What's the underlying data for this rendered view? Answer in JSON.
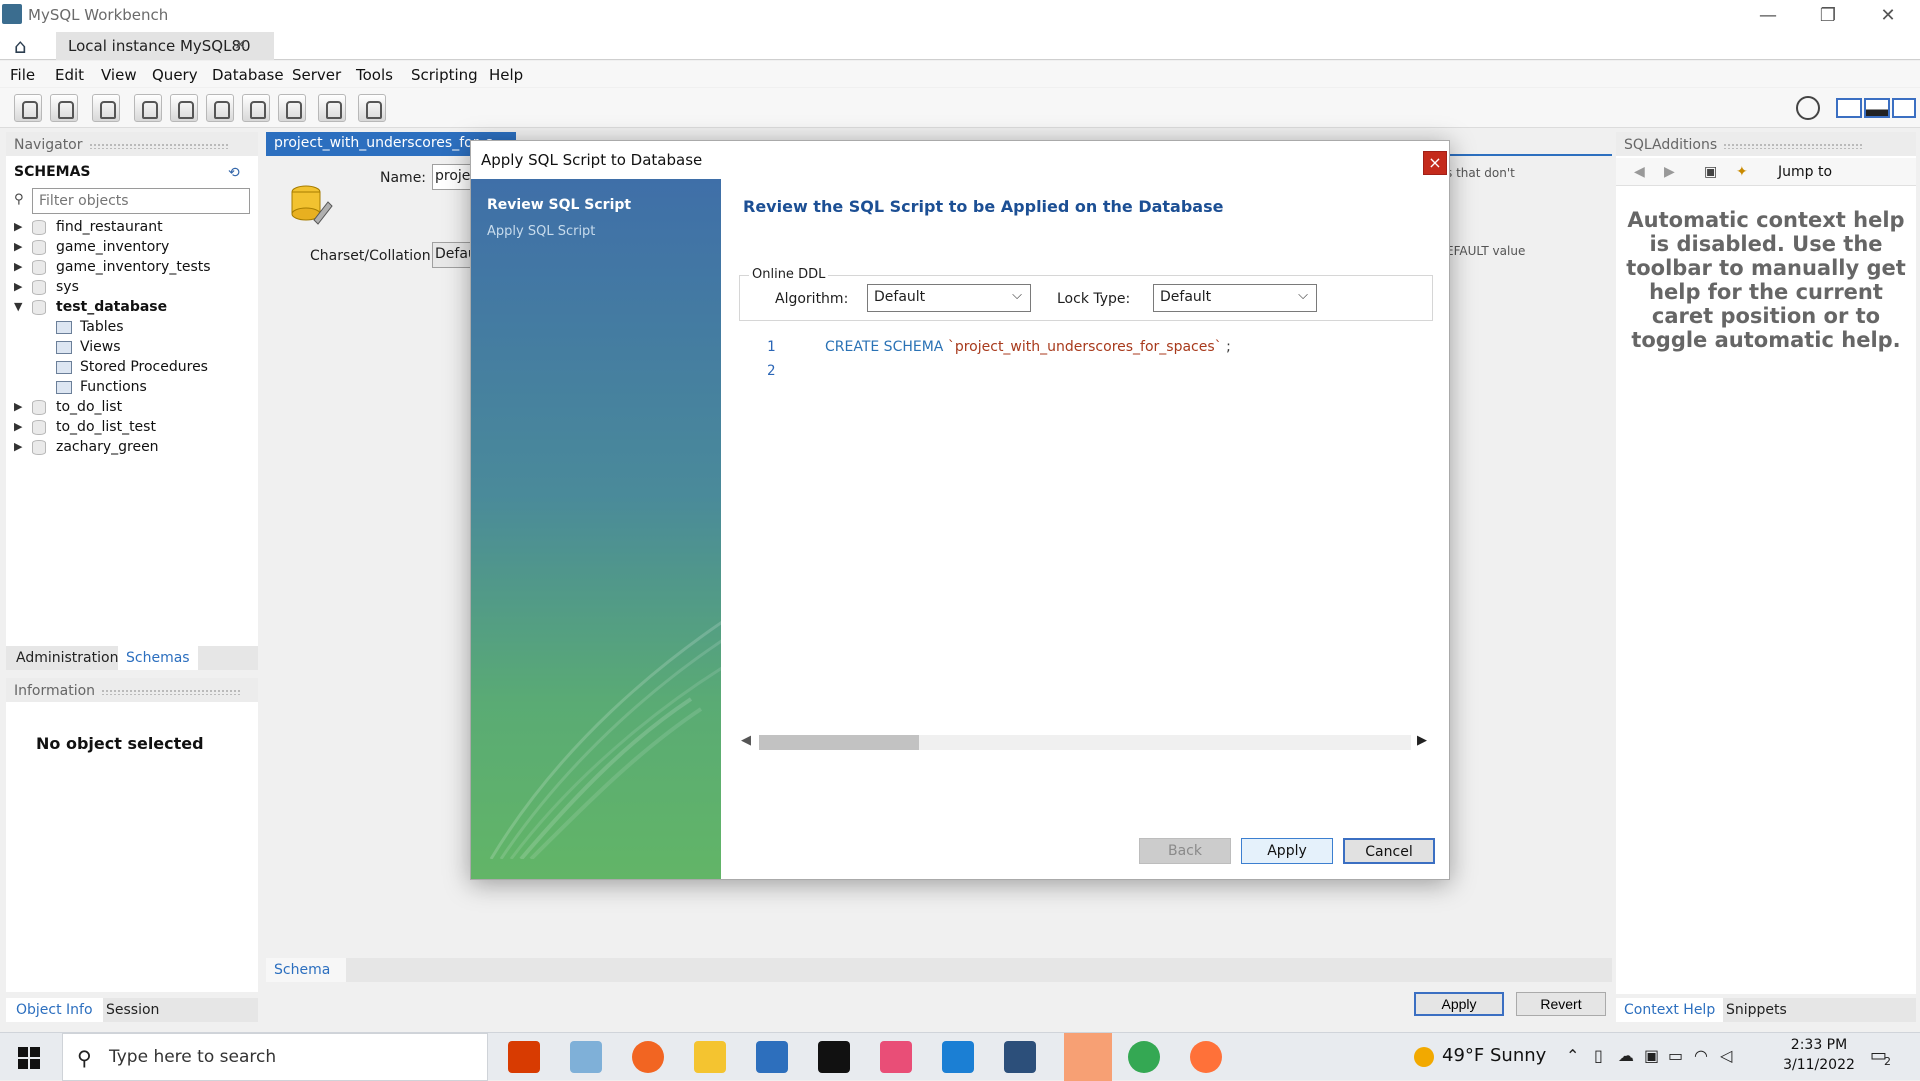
{
  "window": {
    "title": "MySQL Workbench",
    "controls": {
      "minimize": "—",
      "restore": "❐",
      "close": "✕"
    }
  },
  "connection_tab": {
    "label": "Local instance MySQL80",
    "close": "×"
  },
  "menu": [
    "File",
    "Edit",
    "View",
    "Query",
    "Database",
    "Server",
    "Tools",
    "Scripting",
    "Help"
  ],
  "navigator": {
    "header": "Navigator",
    "schemas_label": "SCHEMAS",
    "filter_placeholder": "Filter objects",
    "schemas": [
      {
        "name": "find_restaurant",
        "expanded": false
      },
      {
        "name": "game_inventory",
        "expanded": false
      },
      {
        "name": "game_inventory_tests",
        "expanded": false
      },
      {
        "name": "sys",
        "expanded": false
      },
      {
        "name": "test_database",
        "expanded": true,
        "children": [
          "Tables",
          "Views",
          "Stored Procedures",
          "Functions"
        ]
      },
      {
        "name": "to_do_list",
        "expanded": false
      },
      {
        "name": "to_do_list_test",
        "expanded": false
      },
      {
        "name": "zachary_green",
        "expanded": false
      }
    ],
    "tabs": [
      "Administration",
      "Schemas"
    ],
    "active_tab": "Schemas"
  },
  "information": {
    "header": "Information",
    "message": "No object selected",
    "tabs": [
      "Object Info",
      "Session"
    ],
    "active_tab": "Object Info"
  },
  "editor": {
    "tab_label": "project_with_underscores_for_s",
    "name_label": "Name:",
    "name_value": "projec",
    "charset_label": "Charset/Collation:",
    "charset_value": "Defau",
    "hint_top": "s that don't",
    "hint_default": "EFAULT value",
    "bottom_tab": "Schema",
    "apply_label": "Apply",
    "revert_label": "Revert"
  },
  "right_panel": {
    "header": "SQLAdditions",
    "jump_to": "Jump to",
    "context_help": "Automatic context help is disabled. Use the toolbar to manually get help for the current caret position or to toggle automatic help.",
    "tabs": [
      "Context Help",
      "Snippets"
    ],
    "active_tab": "Context Help"
  },
  "dialog": {
    "title": "Apply SQL Script to Database",
    "close": "×",
    "steps": [
      "Review SQL Script",
      "Apply SQL Script"
    ],
    "active_step": "Review SQL Script",
    "heading": "Review the SQL Script to be Applied on the Database",
    "online_ddl_label": "Online DDL",
    "algorithm_label": "Algorithm:",
    "algorithm_value": "Default",
    "lock_label": "Lock Type:",
    "lock_value": "Default",
    "code": {
      "line_numbers": [
        "1",
        "2"
      ],
      "keyword": "CREATE SCHEMA",
      "identifier": "`project_with_underscores_for_spaces`",
      "terminator": ";"
    },
    "buttons": {
      "back": "Back",
      "apply": "Apply",
      "cancel": "Cancel"
    }
  },
  "taskbar": {
    "search_placeholder": "Type here to search",
    "weather": "49°F  Sunny",
    "time": "2:33 PM",
    "date": "3/11/2022",
    "notifications": "2"
  },
  "colors": {
    "accent_blue": "#2c6fbf",
    "dialog_heading": "#1c4f94",
    "close_red": "#c42b1c",
    "sql_keyword": "#2a72b5",
    "sql_identifier": "#a83a1c"
  }
}
